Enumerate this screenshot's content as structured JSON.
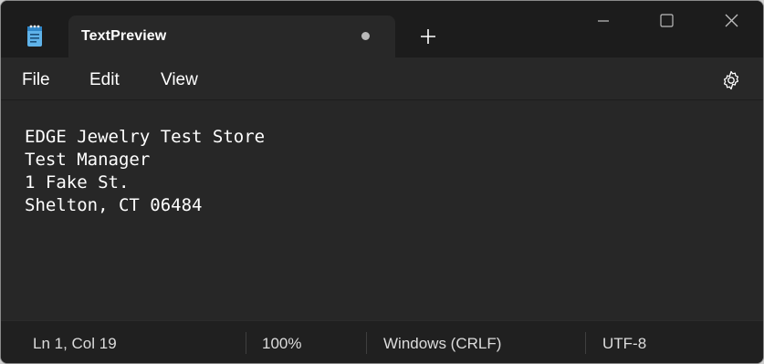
{
  "app": {
    "tab_title": "TextPreview",
    "icon": "notepad-icon"
  },
  "titlebar": {
    "new_tab_icon": "plus-icon",
    "minimize_icon": "minimize-icon",
    "maximize_icon": "maximize-icon",
    "close_icon": "close-icon"
  },
  "menu": {
    "file": "File",
    "edit": "Edit",
    "view": "View",
    "settings_icon": "gear-icon"
  },
  "editor": {
    "lines": [
      "EDGE Jewelry Test Store",
      "Test Manager",
      "1 Fake St.",
      "Shelton, CT 06484"
    ]
  },
  "status": {
    "position": "Ln 1, Col 19",
    "zoom": "100%",
    "line_ending": "Windows (CRLF)",
    "encoding": "UTF-8"
  },
  "colors": {
    "background": "#202020",
    "editor_bg": "#272727",
    "text": "#ffffff"
  }
}
